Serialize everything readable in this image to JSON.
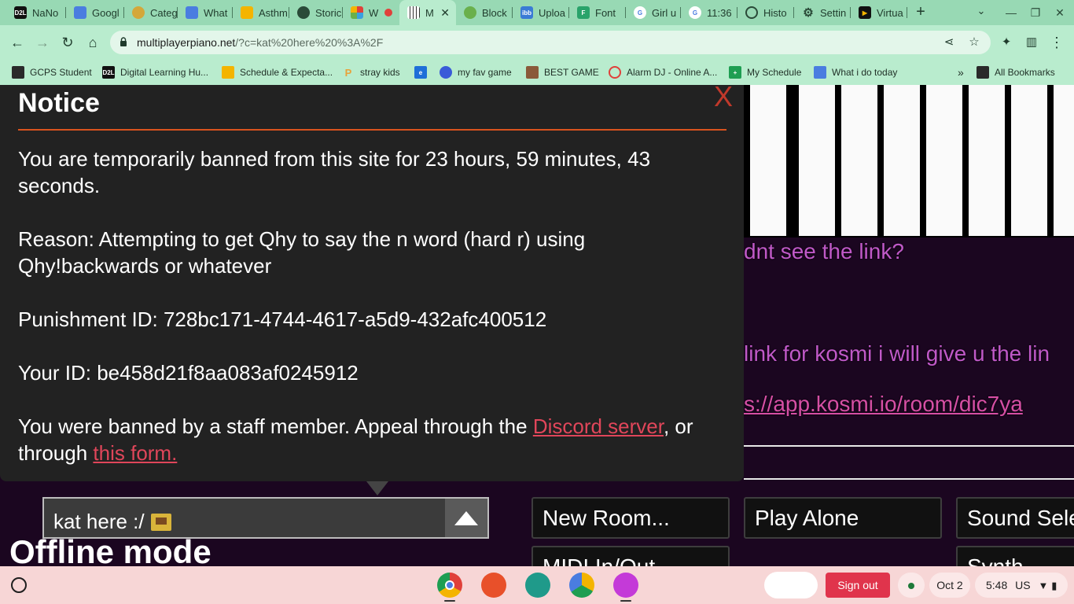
{
  "tabs": [
    {
      "label": "NaNo",
      "favicon": "d2l-icon",
      "color": "#111111"
    },
    {
      "label": "Googl",
      "favicon": "docs-icon",
      "color": "#4a7de0"
    },
    {
      "label": "Categ",
      "favicon": "pin-icon",
      "color": "#d4a73a"
    },
    {
      "label": "What",
      "favicon": "docs-icon",
      "color": "#4a7de0"
    },
    {
      "label": "Asthm",
      "favicon": "slides-icon",
      "color": "#f4b400"
    },
    {
      "label": "Storic",
      "favicon": "pin-icon",
      "color": "#2a4a38"
    },
    {
      "label": "W",
      "favicon": "mosaic-icon",
      "color": "#e0403a"
    },
    {
      "label": "M",
      "favicon": "piano-icon",
      "color": "#333333",
      "active": true
    },
    {
      "label": "Block",
      "favicon": "blocks-icon",
      "color": "#6ab04c"
    },
    {
      "label": "Uploa",
      "favicon": "ibb-icon",
      "color": "#3a7bd5"
    },
    {
      "label": "Font",
      "favicon": "font-icon",
      "color": "#29a36a"
    },
    {
      "label": "Girl u",
      "favicon": "google-icon",
      "color": "#ffffff"
    },
    {
      "label": "11:36",
      "favicon": "google-icon",
      "color": "#ffffff"
    },
    {
      "label": "Histo",
      "favicon": "history-icon",
      "color": "#2a4a38"
    },
    {
      "label": "Settin",
      "favicon": "gear-icon",
      "color": "#2a4a38"
    },
    {
      "label": "Virtua",
      "favicon": "play-icon",
      "color": "#111111"
    }
  ],
  "active_tab_close": "✕",
  "new_tab": "+",
  "tab_search": "⌄",
  "window_controls": {
    "minimize": "—",
    "restore": "❐",
    "close": "✕"
  },
  "omnibox": {
    "host": "multiplayerpiano.net",
    "path": "/?c=kat%20here%20%3A%2F"
  },
  "bookmarks": [
    {
      "label": "GCPS Student",
      "icon": "folder-icon",
      "color": "#2a2a2a"
    },
    {
      "label": "Digital Learning Hu...",
      "icon": "d2l-icon",
      "color": "#111111"
    },
    {
      "label": "Schedule & Expecta...",
      "icon": "slides-icon",
      "color": "#f4b400"
    },
    {
      "label": "stray kids",
      "icon": "pinterest-icon",
      "color": "#e8a23a"
    },
    {
      "label": "",
      "icon": "edge-icon",
      "color": "#1e6fd8"
    },
    {
      "label": "my fav game",
      "icon": "game-icon",
      "color": "#3a5bd8"
    },
    {
      "label": "BEST GAME",
      "icon": "face-icon",
      "color": "#8a5a3a"
    },
    {
      "label": "Alarm DJ - Online A...",
      "icon": "alarm-icon",
      "color": "#e0403a"
    },
    {
      "label": "My Schedule",
      "icon": "sheets-icon",
      "color": "#1e9e52"
    },
    {
      "label": "What i do today",
      "icon": "docs-icon",
      "color": "#4a7de0"
    },
    {
      "label": "»",
      "icon": "chevron-icon",
      "color": "#2a2a2a"
    },
    {
      "label": "All Bookmarks",
      "icon": "folder-icon",
      "color": "#2a2a2a"
    }
  ],
  "chat_lines": [
    {
      "text": "dnt see the link?",
      "link": false
    },
    {
      "text": "link for kosmi i will give u the lin",
      "link": false
    },
    {
      "text": "s://app.kosmi.io/room/dic7ya",
      "link": true
    }
  ],
  "notice": {
    "title": "Notice",
    "close": "X",
    "ban_text": "You are temporarily banned from this site for 23 hours, 59 minutes, 43 seconds.",
    "reason": "Reason: Attempting to get Qhy to say the n word (hard r) using Qhy!backwards or whatever",
    "punishment_id": "Punishment ID: 728bc171-4744-4617-a5d9-432afc400512",
    "your_id": "Your ID: be458d21f8aa083af0245912",
    "appeal_prefix": "You were banned by a staff member. Appeal through the ",
    "discord_link": "Discord server",
    "appeal_mid": ", or through ",
    "form_link": "this form."
  },
  "chat_input": {
    "value": "kat here :/"
  },
  "offline_label": "Offline mode",
  "buttons": {
    "new_room": "New Room...",
    "play_alone": "Play Alone",
    "sound_select": "Sound Sele",
    "midi": "MIDI In/Out",
    "synth": "Synth"
  },
  "shelf": {
    "sign_out": "Sign out",
    "date": "Oct 2",
    "time": "5:48",
    "locale": "US",
    "apps": [
      {
        "name": "chrome-icon",
        "color": "#e0403a"
      },
      {
        "name": "palette-icon",
        "color": "#e8502a"
      },
      {
        "name": "classroom-icon",
        "color": "#1f9a8a"
      },
      {
        "name": "drive-icon",
        "color": "#f4b400"
      },
      {
        "name": "canvas-icon",
        "color": "#c43ad8"
      }
    ]
  }
}
